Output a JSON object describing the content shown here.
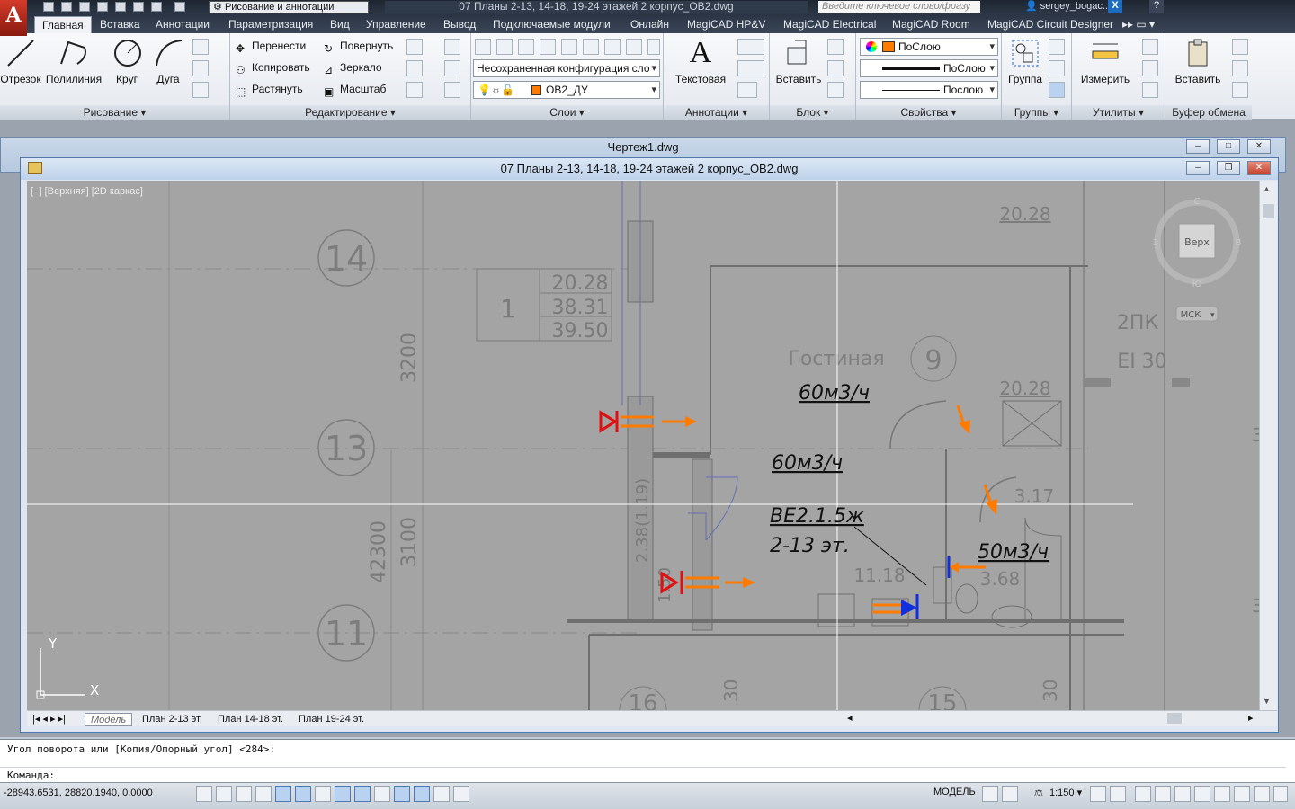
{
  "app": {
    "workspace": "Рисование и аннотации",
    "file_title": "07 Планы 2-13, 14-18, 19-24 этажей 2 корпус_ОВ2.dwg",
    "search_placeholder": "Введите ключевое слово/фразу",
    "user": "sergey_bogac..."
  },
  "ribbon_tabs": [
    "Главная",
    "Вставка",
    "Аннотации",
    "Параметризация",
    "Вид",
    "Управление",
    "Вывод",
    "Подключаемые модули",
    "Онлайн",
    "MagiCAD HP&V",
    "MagiCAD Electrical",
    "MagiCAD Room",
    "MagiCAD Circuit Designer"
  ],
  "panels": {
    "draw": {
      "label": "Рисование",
      "tools": [
        "Отрезок",
        "Полилиния",
        "Круг",
        "Дуга"
      ]
    },
    "modify": {
      "label": "Редактирование",
      "tools": [
        "Перенести",
        "Повернуть",
        "Копировать",
        "Зеркало",
        "Растянуть",
        "Масштаб"
      ]
    },
    "layers": {
      "label": "Слои",
      "state": "Несохраненная конфигурация сло",
      "current": "ОВ2_ДУ"
    },
    "annotation": {
      "label": "Аннотации",
      "tool": "Текстовая"
    },
    "block": {
      "label": "Блок",
      "tool": "Вставить"
    },
    "properties": {
      "label": "Свойства",
      "color": "ПоСлою",
      "linetype": "ПоСлою",
      "lineweight": "Послою"
    },
    "groups": {
      "label": "Группы",
      "tool": "Группа"
    },
    "utilities": {
      "label": "Утилиты",
      "tool": "Измерить"
    },
    "clipboard": {
      "label": "Буфер обмена",
      "tool": "Вставить"
    }
  },
  "windows": {
    "background": "Чертеж1.dwg",
    "active": "07 Планы 2-13, 14-18, 19-24 этажей 2 корпус_ОВ2.dwg"
  },
  "viewport": {
    "label": "[−] [Верхняя] [2D каркас]",
    "viewcube": "Верх",
    "ucs": "МСК",
    "compass": [
      "С",
      "Ю",
      "З",
      "В"
    ]
  },
  "drawing": {
    "axes": [
      "14",
      "13",
      "11"
    ],
    "dims": [
      "3200",
      "3100",
      "42300",
      "2.38(1.19)",
      "1.50",
      "30",
      "30"
    ],
    "room_table": [
      "1",
      "20.28",
      "38.31",
      "39.50"
    ],
    "room_name": "Гостиная",
    "room_number": "9",
    "areas": [
      "20.28",
      "20.28",
      "3.17",
      "11.18",
      "3.68"
    ],
    "flows": [
      "60м3/ч",
      "60м3/ч",
      "50м3/ч"
    ],
    "note_line1": "ВЕ2.1.5ж",
    "note_line2": "2-13 эт.",
    "fire_door": "2ПК",
    "fire_rating": "EI 30",
    "room_bottom": [
      "16",
      "15"
    ],
    "partial_text": [
      "3",
      "3",
      "3"
    ]
  },
  "layout_tabs": [
    "Модель",
    "План 2-13 эт.",
    "План 14-18 эт.",
    "План 19-24 эт."
  ],
  "command": {
    "history": "Угол поворота или [Копия/Опорный угол] <284>:",
    "prompt": "Команда:"
  },
  "status": {
    "coords": "-28943.6531, 28820.1940, 0.0000",
    "space": "МОДЕЛЬ",
    "scale": "1:150"
  },
  "colors": {
    "accent_orange": "#ff7a00",
    "accent_red": "#e01010",
    "accent_blue": "#1030e0",
    "canvas_bg": "#a4a4a4"
  }
}
